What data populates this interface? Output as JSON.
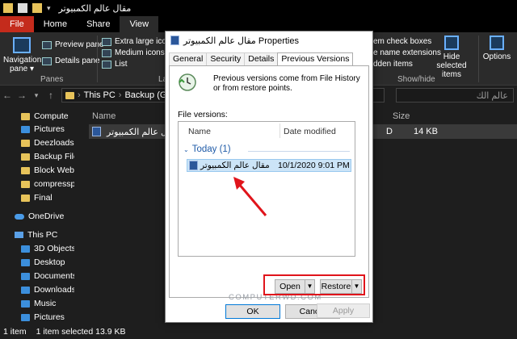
{
  "window": {
    "title": "مقال عالم الكمبيوتر"
  },
  "ribbon": {
    "tabs": [
      "File",
      "Home",
      "Share",
      "View"
    ],
    "nav_pane": "Navigation pane",
    "preview_pane": "Preview pane",
    "details_pane": "Details pane",
    "panes_label": "Panes",
    "extra_large": "Extra large icons",
    "medium_icons": "Medium icons",
    "list": "List",
    "layout_label": "La",
    "check_boxes": "em check boxes",
    "name_ext": "e name extensions",
    "hidden_items": "dden items",
    "hide_selected": "Hide selected items",
    "show_hide_label": "Show/hide",
    "options": "Options"
  },
  "address": {
    "this_pc": "This PC",
    "drive": "Backup (G:)",
    "search_placeholder": "عالم الك"
  },
  "sidebar": {
    "items": [
      "Compute",
      "Pictures",
      "Deezloads",
      "Backup File H",
      "Block Websit",
      "compresspnc",
      "Final",
      "OneDrive",
      "This PC",
      "3D Objects",
      "Desktop",
      "Documents",
      "Downloads",
      "Music",
      "Pictures"
    ]
  },
  "filelist": {
    "col_name": "Name",
    "col_size": "Size",
    "file_name": "مقال عالم الكمبيوتر",
    "file_type": "D",
    "file_size": "14 KB"
  },
  "status": {
    "count": "1 item",
    "selected": "1 item selected  13.9 KB"
  },
  "dialog": {
    "title": "مقال عالم الكمبيوتر Properties",
    "tabs": [
      "General",
      "Security",
      "Details",
      "Previous Versions"
    ],
    "description": "Previous versions come from File History or from restore points.",
    "file_versions_label": "File versions:",
    "col_name": "Name",
    "col_date": "Date modified",
    "group_label": "Today (1)",
    "version_name": "مقال عالم الكمبيوتر",
    "version_date": "10/1/2020 9:01 PM",
    "watermark": "COMPUTERWD.COM",
    "open": "Open",
    "restore": "Restore",
    "ok": "OK",
    "cancel": "Cancel",
    "apply": "Apply"
  },
  "colors": {
    "file_tab": "#c42b1c",
    "selection": "#cce4f7",
    "highlight_frame": "#e0141b",
    "annotation_arrow": "#e0141b"
  }
}
